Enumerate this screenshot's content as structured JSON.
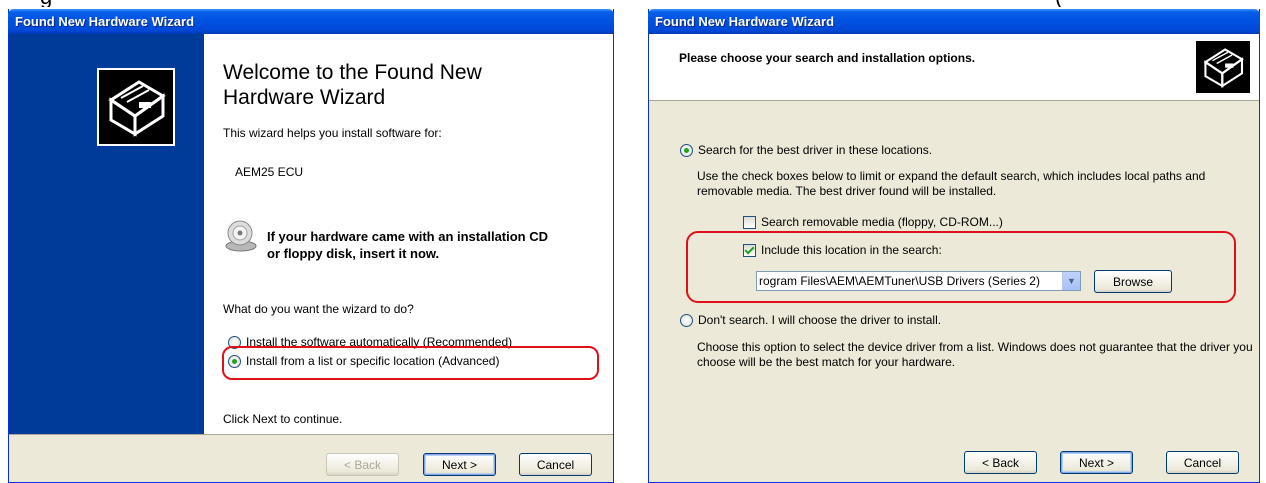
{
  "caption": {
    "left": "g",
    "right": "("
  },
  "wizard1": {
    "title": "Found New Hardware Wizard",
    "welcome_title_line1": "Welcome to the Found New",
    "welcome_title_line2": "Hardware Wizard",
    "helps_text": "This wizard helps you install software for:",
    "device_name": "AEM25 ECU",
    "cd_message_line1": "If your hardware came with an installation CD",
    "cd_message_line2": "or floppy disk, insert it now.",
    "question": "What do you want the wizard to do?",
    "options": [
      {
        "label": "Install the software automatically (Recommended)",
        "selected": false
      },
      {
        "label": "Install from a list or specific location (Advanced)",
        "selected": true
      }
    ],
    "continue_text": "Click Next to continue.",
    "buttons": {
      "back": "< Back",
      "next": "Next >",
      "cancel": "Cancel"
    }
  },
  "wizard2": {
    "title": "Found New Hardware Wizard",
    "heading": "Please choose your search and installation options.",
    "option_search": {
      "label": "Search for the best driver in these locations.",
      "selected": true
    },
    "search_description": "Use the check boxes below to limit or expand the default search, which includes local paths and removable media. The best driver found will be installed.",
    "checkbox_removable": {
      "label": "Search removable media (floppy, CD-ROM...)",
      "checked": false
    },
    "checkbox_location": {
      "label": "Include this location in the search:",
      "checked": true
    },
    "location_path": "rogram Files\\AEM\\AEMTuner\\USB Drivers (Series 2)",
    "browse_label": "Browse",
    "option_dont_search": {
      "label": "Don't search. I will choose the driver to install.",
      "selected": false
    },
    "dont_search_description": "Choose this option to select the device driver from a list.  Windows does not guarantee that the driver you choose will be the best match for your hardware.",
    "buttons": {
      "back": "< Back",
      "next": "Next >",
      "cancel": "Cancel"
    }
  }
}
